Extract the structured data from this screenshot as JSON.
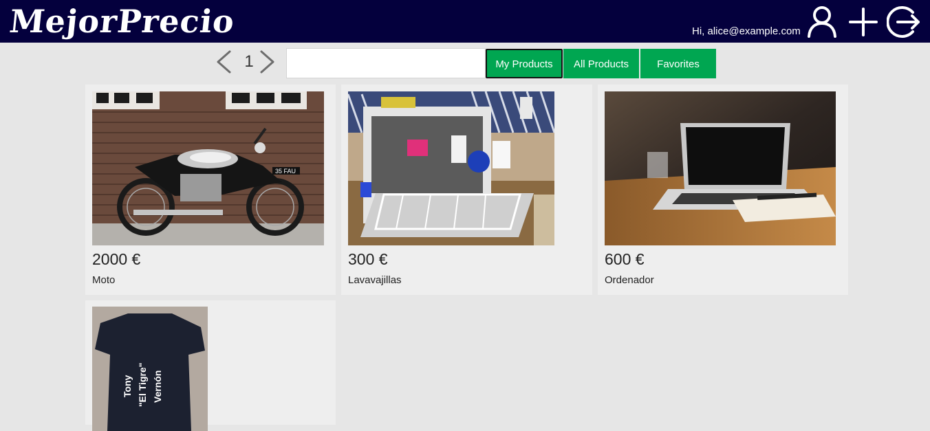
{
  "header": {
    "logo": "MejorPrecio",
    "greeting": "Hi, alice@example.com",
    "icons": [
      "user-icon",
      "add-icon",
      "logout-icon"
    ],
    "background_color": "#04003d"
  },
  "toolbar": {
    "page_number": "1",
    "search": {
      "value": "",
      "placeholder": ""
    },
    "tabs": [
      {
        "label": "My Products",
        "active": true
      },
      {
        "label": "All Products",
        "active": false
      },
      {
        "label": "Favorites",
        "active": false
      }
    ],
    "accent_color": "#00a651"
  },
  "products": [
    {
      "price": "2000 €",
      "name": "Moto",
      "image": "motorcycle photo"
    },
    {
      "price": "300 €",
      "name": "Lavavajillas",
      "image": "dishwasher photo"
    },
    {
      "price": "600 €",
      "name": "Ordenador",
      "image": "laptop photo"
    },
    {
      "price": "",
      "name": "",
      "image": "t-shirt photo",
      "image_text": "Tony \"El Tigre\" Vernón"
    }
  ]
}
